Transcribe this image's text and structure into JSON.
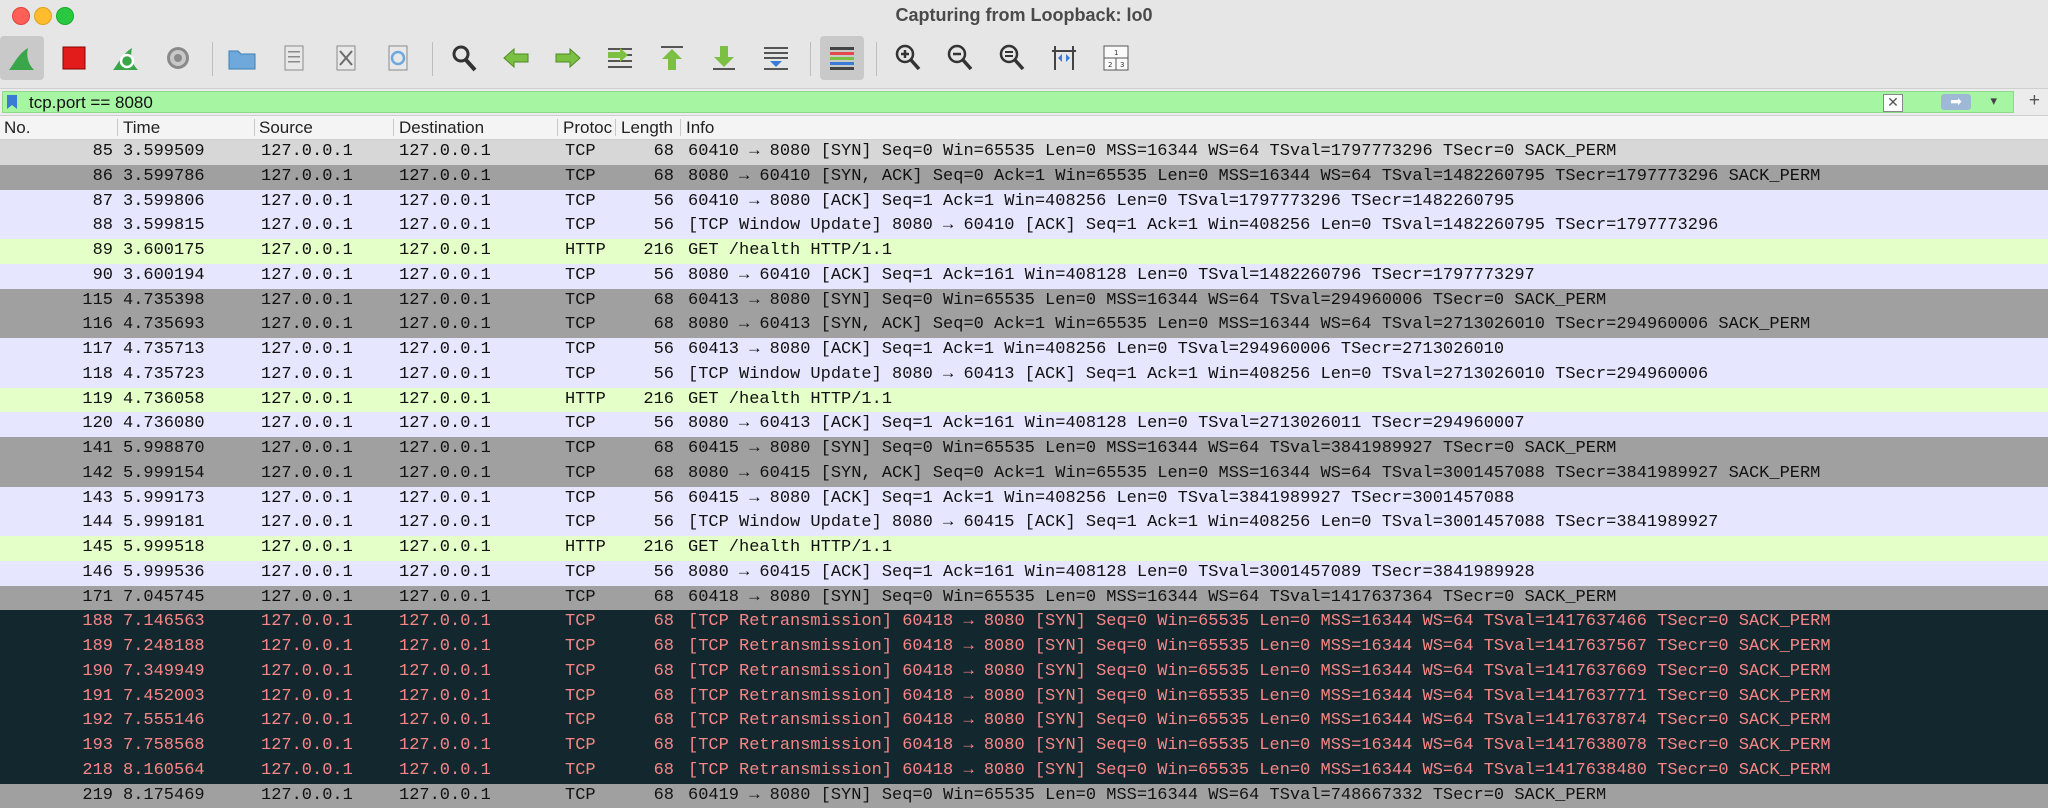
{
  "window": {
    "title": "Capturing from Loopback: lo0"
  },
  "toolbar": {
    "buttons": [
      {
        "icon": "shark-fin-start-icon"
      },
      {
        "icon": "stop-capture-icon"
      },
      {
        "icon": "restart-capture-icon"
      },
      {
        "icon": "capture-options-gear-icon"
      },
      {
        "icon": "open-folder-icon"
      },
      {
        "icon": "save-file-icon"
      },
      {
        "icon": "close-file-icon"
      },
      {
        "icon": "reload-file-icon"
      },
      {
        "icon": "find-packet-icon"
      },
      {
        "icon": "go-back-icon"
      },
      {
        "icon": "go-forward-icon"
      },
      {
        "icon": "go-to-packet-icon"
      },
      {
        "icon": "go-first-packet-icon"
      },
      {
        "icon": "go-last-packet-icon"
      },
      {
        "icon": "autoscroll-icon"
      },
      {
        "icon": "colorize-icon"
      },
      {
        "icon": "zoom-in-icon"
      },
      {
        "icon": "zoom-out-icon"
      },
      {
        "icon": "normal-size-icon"
      },
      {
        "icon": "resize-columns-icon"
      },
      {
        "icon": "layout-icon"
      }
    ]
  },
  "filter": {
    "value": "tcp.port == 8080"
  },
  "columns": {
    "no": "No.",
    "time": "Time",
    "source": "Source",
    "destination": "Destination",
    "protocol": "Protoc",
    "length": "Length",
    "info": "Info"
  },
  "colors": {
    "syn_row": "#a0a0a0",
    "tcp_row": "#e7e6ff",
    "http_row": "#e4ffc7",
    "bad_row_bg": "#12272e",
    "bad_row_fg": "#f78787",
    "filter_valid": "#a5f5a3"
  },
  "packets": [
    {
      "no": "85",
      "time": "3.599509",
      "src": "127.0.0.1",
      "dst": "127.0.0.1",
      "proto": "TCP",
      "len": "68",
      "info": "60410 → 8080 [SYN] Seq=0 Win=65535 Len=0 MSS=16344 WS=64 TSval=1797773296 TSecr=0 SACK_PERM",
      "style": "first"
    },
    {
      "no": "86",
      "time": "3.599786",
      "src": "127.0.0.1",
      "dst": "127.0.0.1",
      "proto": "TCP",
      "len": "68",
      "info": "8080 → 60410 [SYN, ACK] Seq=0 Ack=1 Win=65535 Len=0 MSS=16344 WS=64 TSval=1482260795 TSecr=1797773296 SACK_PERM",
      "style": "syn"
    },
    {
      "no": "87",
      "time": "3.599806",
      "src": "127.0.0.1",
      "dst": "127.0.0.1",
      "proto": "TCP",
      "len": "56",
      "info": "60410 → 8080 [ACK] Seq=1 Ack=1 Win=408256 Len=0 TSval=1797773296 TSecr=1482260795",
      "style": "tcp"
    },
    {
      "no": "88",
      "time": "3.599815",
      "src": "127.0.0.1",
      "dst": "127.0.0.1",
      "proto": "TCP",
      "len": "56",
      "info": "[TCP Window Update] 8080 → 60410 [ACK] Seq=1 Ack=1 Win=408256 Len=0 TSval=1482260795 TSecr=1797773296",
      "style": "tcp"
    },
    {
      "no": "89",
      "time": "3.600175",
      "src": "127.0.0.1",
      "dst": "127.0.0.1",
      "proto": "HTTP",
      "len": "216",
      "info": "GET /health HTTP/1.1",
      "style": "http"
    },
    {
      "no": "90",
      "time": "3.600194",
      "src": "127.0.0.1",
      "dst": "127.0.0.1",
      "proto": "TCP",
      "len": "56",
      "info": "8080 → 60410 [ACK] Seq=1 Ack=161 Win=408128 Len=0 TSval=1482260796 TSecr=1797773297",
      "style": "tcp"
    },
    {
      "no": "115",
      "time": "4.735398",
      "src": "127.0.0.1",
      "dst": "127.0.0.1",
      "proto": "TCP",
      "len": "68",
      "info": "60413 → 8080 [SYN] Seq=0 Win=65535 Len=0 MSS=16344 WS=64 TSval=294960006 TSecr=0 SACK_PERM",
      "style": "syn"
    },
    {
      "no": "116",
      "time": "4.735693",
      "src": "127.0.0.1",
      "dst": "127.0.0.1",
      "proto": "TCP",
      "len": "68",
      "info": "8080 → 60413 [SYN, ACK] Seq=0 Ack=1 Win=65535 Len=0 MSS=16344 WS=64 TSval=2713026010 TSecr=294960006 SACK_PERM",
      "style": "syn"
    },
    {
      "no": "117",
      "time": "4.735713",
      "src": "127.0.0.1",
      "dst": "127.0.0.1",
      "proto": "TCP",
      "len": "56",
      "info": "60413 → 8080 [ACK] Seq=1 Ack=1 Win=408256 Len=0 TSval=294960006 TSecr=2713026010",
      "style": "tcp"
    },
    {
      "no": "118",
      "time": "4.735723",
      "src": "127.0.0.1",
      "dst": "127.0.0.1",
      "proto": "TCP",
      "len": "56",
      "info": "[TCP Window Update] 8080 → 60413 [ACK] Seq=1 Ack=1 Win=408256 Len=0 TSval=2713026010 TSecr=294960006",
      "style": "tcp"
    },
    {
      "no": "119",
      "time": "4.736058",
      "src": "127.0.0.1",
      "dst": "127.0.0.1",
      "proto": "HTTP",
      "len": "216",
      "info": "GET /health HTTP/1.1",
      "style": "http"
    },
    {
      "no": "120",
      "time": "4.736080",
      "src": "127.0.0.1",
      "dst": "127.0.0.1",
      "proto": "TCP",
      "len": "56",
      "info": "8080 → 60413 [ACK] Seq=1 Ack=161 Win=408128 Len=0 TSval=2713026011 TSecr=294960007",
      "style": "tcp"
    },
    {
      "no": "141",
      "time": "5.998870",
      "src": "127.0.0.1",
      "dst": "127.0.0.1",
      "proto": "TCP",
      "len": "68",
      "info": "60415 → 8080 [SYN] Seq=0 Win=65535 Len=0 MSS=16344 WS=64 TSval=3841989927 TSecr=0 SACK_PERM",
      "style": "syn"
    },
    {
      "no": "142",
      "time": "5.999154",
      "src": "127.0.0.1",
      "dst": "127.0.0.1",
      "proto": "TCP",
      "len": "68",
      "info": "8080 → 60415 [SYN, ACK] Seq=0 Ack=1 Win=65535 Len=0 MSS=16344 WS=64 TSval=3001457088 TSecr=3841989927 SACK_PERM",
      "style": "syn"
    },
    {
      "no": "143",
      "time": "5.999173",
      "src": "127.0.0.1",
      "dst": "127.0.0.1",
      "proto": "TCP",
      "len": "56",
      "info": "60415 → 8080 [ACK] Seq=1 Ack=1 Win=408256 Len=0 TSval=3841989927 TSecr=3001457088",
      "style": "tcp"
    },
    {
      "no": "144",
      "time": "5.999181",
      "src": "127.0.0.1",
      "dst": "127.0.0.1",
      "proto": "TCP",
      "len": "56",
      "info": "[TCP Window Update] 8080 → 60415 [ACK] Seq=1 Ack=1 Win=408256 Len=0 TSval=3001457088 TSecr=3841989927",
      "style": "tcp"
    },
    {
      "no": "145",
      "time": "5.999518",
      "src": "127.0.0.1",
      "dst": "127.0.0.1",
      "proto": "HTTP",
      "len": "216",
      "info": "GET /health HTTP/1.1",
      "style": "http"
    },
    {
      "no": "146",
      "time": "5.999536",
      "src": "127.0.0.1",
      "dst": "127.0.0.1",
      "proto": "TCP",
      "len": "56",
      "info": "8080 → 60415 [ACK] Seq=1 Ack=161 Win=408128 Len=0 TSval=3001457089 TSecr=3841989928",
      "style": "tcp"
    },
    {
      "no": "171",
      "time": "7.045745",
      "src": "127.0.0.1",
      "dst": "127.0.0.1",
      "proto": "TCP",
      "len": "68",
      "info": "60418 → 8080 [SYN] Seq=0 Win=65535 Len=0 MSS=16344 WS=64 TSval=1417637364 TSecr=0 SACK_PERM",
      "style": "syn"
    },
    {
      "no": "188",
      "time": "7.146563",
      "src": "127.0.0.1",
      "dst": "127.0.0.1",
      "proto": "TCP",
      "len": "68",
      "info": "[TCP Retransmission] 60418 → 8080 [SYN] Seq=0 Win=65535 Len=0 MSS=16344 WS=64 TSval=1417637466 TSecr=0 SACK_PERM",
      "style": "bad"
    },
    {
      "no": "189",
      "time": "7.248188",
      "src": "127.0.0.1",
      "dst": "127.0.0.1",
      "proto": "TCP",
      "len": "68",
      "info": "[TCP Retransmission] 60418 → 8080 [SYN] Seq=0 Win=65535 Len=0 MSS=16344 WS=64 TSval=1417637567 TSecr=0 SACK_PERM",
      "style": "bad"
    },
    {
      "no": "190",
      "time": "7.349949",
      "src": "127.0.0.1",
      "dst": "127.0.0.1",
      "proto": "TCP",
      "len": "68",
      "info": "[TCP Retransmission] 60418 → 8080 [SYN] Seq=0 Win=65535 Len=0 MSS=16344 WS=64 TSval=1417637669 TSecr=0 SACK_PERM",
      "style": "bad"
    },
    {
      "no": "191",
      "time": "7.452003",
      "src": "127.0.0.1",
      "dst": "127.0.0.1",
      "proto": "TCP",
      "len": "68",
      "info": "[TCP Retransmission] 60418 → 8080 [SYN] Seq=0 Win=65535 Len=0 MSS=16344 WS=64 TSval=1417637771 TSecr=0 SACK_PERM",
      "style": "bad"
    },
    {
      "no": "192",
      "time": "7.555146",
      "src": "127.0.0.1",
      "dst": "127.0.0.1",
      "proto": "TCP",
      "len": "68",
      "info": "[TCP Retransmission] 60418 → 8080 [SYN] Seq=0 Win=65535 Len=0 MSS=16344 WS=64 TSval=1417637874 TSecr=0 SACK_PERM",
      "style": "bad"
    },
    {
      "no": "193",
      "time": "7.758568",
      "src": "127.0.0.1",
      "dst": "127.0.0.1",
      "proto": "TCP",
      "len": "68",
      "info": "[TCP Retransmission] 60418 → 8080 [SYN] Seq=0 Win=65535 Len=0 MSS=16344 WS=64 TSval=1417638078 TSecr=0 SACK_PERM",
      "style": "bad"
    },
    {
      "no": "218",
      "time": "8.160564",
      "src": "127.0.0.1",
      "dst": "127.0.0.1",
      "proto": "TCP",
      "len": "68",
      "info": "[TCP Retransmission] 60418 → 8080 [SYN] Seq=0 Win=65535 Len=0 MSS=16344 WS=64 TSval=1417638480 TSecr=0 SACK_PERM",
      "style": "bad"
    },
    {
      "no": "219",
      "time": "8.175469",
      "src": "127.0.0.1",
      "dst": "127.0.0.1",
      "proto": "TCP",
      "len": "68",
      "info": "60419 → 8080 [SYN] Seq=0 Win=65535 Len=0 MSS=16344 WS=64 TSval=748667332 TSecr=0 SACK_PERM",
      "style": "syn"
    }
  ]
}
